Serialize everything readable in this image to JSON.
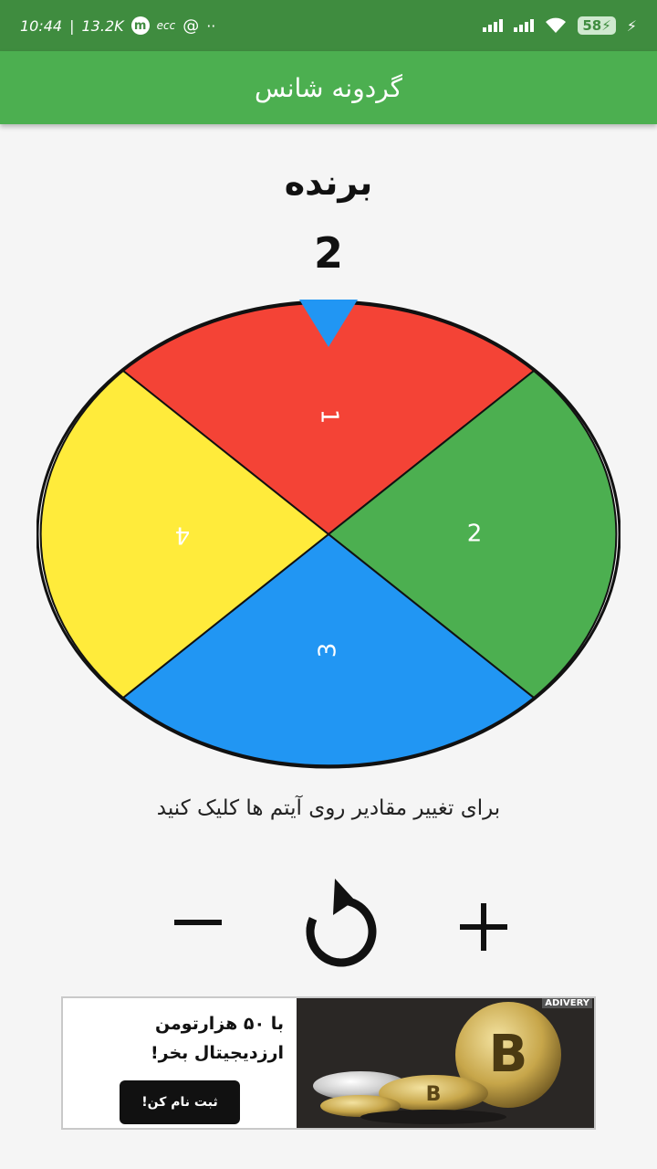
{
  "status_bar": {
    "time": "10:44",
    "speed": "13.2K",
    "badge_letter": "m",
    "extra_label": "ecc",
    "battery": "58"
  },
  "app_bar": {
    "title": "گردونه شانس"
  },
  "winner": {
    "label": "برنده",
    "value": "2"
  },
  "wheel": {
    "segments": [
      {
        "label": "1",
        "color": "#f44336"
      },
      {
        "label": "2",
        "color": "#4caf50"
      },
      {
        "label": "3",
        "color": "#2196f3"
      },
      {
        "label": "4",
        "color": "#ffeb3b"
      }
    ],
    "pointer_color": "#2196f3"
  },
  "hint": "برای تغییر مقادیر روی آیتم ها کلیک کنید",
  "controls": [
    "minus-icon",
    "refresh-icon",
    "plus-icon"
  ],
  "ad": {
    "line1": "با ۵۰ هزارتومن",
    "line2": "ارزدیجیتال بخر!",
    "button": "ثبت نام کن!",
    "tag": "ADIVERY"
  },
  "colors": {
    "appbar": "#4caf50",
    "statusbar": "#3f8c3f"
  }
}
